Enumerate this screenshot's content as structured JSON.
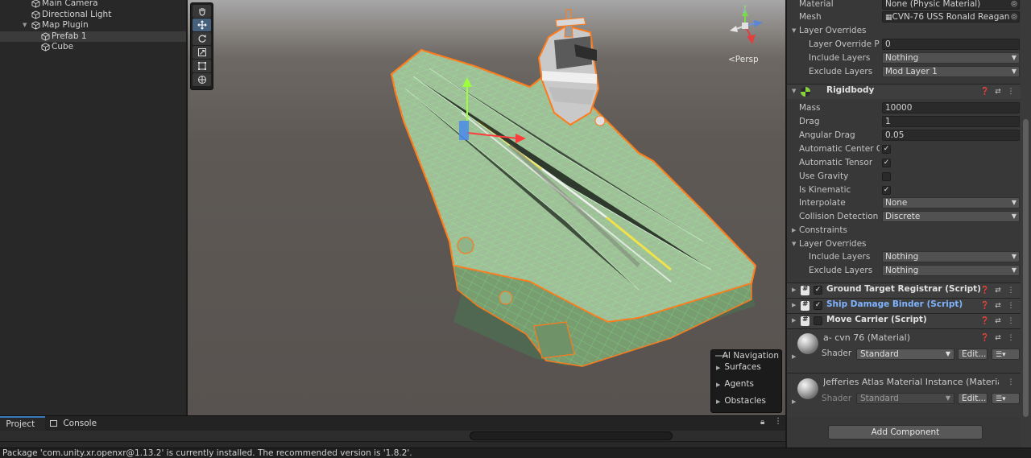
{
  "hierarchy": {
    "items": [
      {
        "label": "Main Camera"
      },
      {
        "label": "Directional Light"
      },
      {
        "label": "Map Plugin"
      },
      {
        "label": "Prefab 1"
      },
      {
        "label": "Cube"
      }
    ]
  },
  "scene": {
    "projection_label": "<Persp",
    "gizmo_axes": {
      "y": "y",
      "z": "z"
    },
    "tools": [
      "hand-icon",
      "move-icon",
      "rotate-icon",
      "scale-icon",
      "rect-icon",
      "transform-icon"
    ],
    "active_tool": 1,
    "ai_navigation": {
      "title": "AI Navigation",
      "items": [
        "Surfaces",
        "Agents",
        "Obstacles"
      ]
    }
  },
  "bottom": {
    "tabs": [
      "Project",
      "Console"
    ],
    "status_message": "Package 'com.unity.xr.openxr@1.13.2' is currently installed. The recommended version is '1.8.2'."
  },
  "inspector": {
    "mesh_collider": {
      "material_label": "Material",
      "material_value": "None (Physic Material)",
      "mesh_label": "Mesh",
      "mesh_value": "CVN-76 USS Ronald Reagan",
      "layer_overrides_label": "Layer Overrides",
      "override_priority_label": "Layer Override Pri",
      "override_priority_value": "0",
      "include_label": "Include Layers",
      "include_value": "Nothing",
      "exclude_label": "Exclude Layers",
      "exclude_value": "Mod Layer 1"
    },
    "rigidbody": {
      "title": "Rigidbody",
      "mass_label": "Mass",
      "mass_value": "10000",
      "drag_label": "Drag",
      "drag_value": "1",
      "angular_drag_label": "Angular Drag",
      "angular_drag_value": "0.05",
      "auto_center_label": "Automatic Center Of",
      "auto_tensor_label": "Automatic Tensor",
      "use_gravity_label": "Use Gravity",
      "is_kinematic_label": "Is Kinematic",
      "interpolate_label": "Interpolate",
      "interpolate_value": "None",
      "collision_label": "Collision Detection",
      "collision_value": "Discrete",
      "constraints_label": "Constraints",
      "layer_overrides_label": "Layer Overrides",
      "include_label": "Include Layers",
      "include_value": "Nothing",
      "exclude_label": "Exclude Layers",
      "exclude_value": "Nothing"
    },
    "scripts": [
      {
        "name": "Ground Target Registrar (Script)",
        "enabled": true
      },
      {
        "name": "Ship Damage Binder (Script)",
        "enabled": true
      },
      {
        "name": "Move Carrier (Script)",
        "enabled": false
      }
    ],
    "materials": [
      {
        "name": "a- cvn 76 (Material)",
        "shader_label": "Shader",
        "shader_value": "Standard",
        "edit_label": "Edit..."
      },
      {
        "name": "Jefferies Atlas Material Instance (Materia",
        "shader_label": "Shader",
        "shader_value": "Standard",
        "edit_label": "Edit..."
      }
    ],
    "add_component_label": "Add Component"
  },
  "colors": {
    "accent_blue": "#3a79bb",
    "wireframe_green": "#7dff7d",
    "selection_orange": "#ff7a1a",
    "script_name_blue": "#7fb4ff"
  }
}
